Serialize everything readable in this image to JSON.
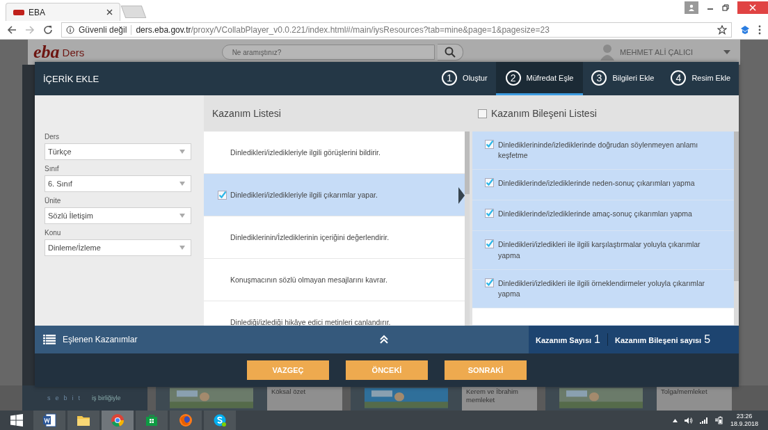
{
  "browser": {
    "tab_title": "EBA",
    "security": "Güvenli değil",
    "url_host": "ders.eba.gov.tr",
    "url_path": "/proxy/VCollabPlayer_v0.0.221/index.html#/main/iysResources?tab=mine&page=1&pagesize=23"
  },
  "page_header": {
    "logo": "eba",
    "logo_sub": "Ders",
    "search": {
      "placeholder": "Ne aramıştınız?"
    },
    "user": "MEHMET ALİ ÇALICI"
  },
  "modal": {
    "title": "İÇERİK EKLE",
    "steps": [
      {
        "number": "1",
        "label": "Oluştur",
        "selected": false
      },
      {
        "number": "2",
        "label": "Müfredat Eşle",
        "selected": true
      },
      {
        "number": "3",
        "label": "Bilgileri Ekle",
        "selected": false
      },
      {
        "number": "4",
        "label": "Resim Ekle",
        "selected": false
      }
    ],
    "filters": [
      {
        "label": "Ders",
        "value": "Türkçe"
      },
      {
        "label": "Sınıf",
        "value": "6. Sınıf"
      },
      {
        "label": "Ünite",
        "value": "Sözlü İletişim"
      },
      {
        "label": "Konu",
        "value": "Dinleme/İzleme"
      }
    ],
    "outcomes": {
      "title": "Kazanım Listesi",
      "items": [
        {
          "text": "Dinledikleri/izledikleriyle ilgili görüşlerini bildirir.",
          "selected": false
        },
        {
          "text": "Dinledikleri/izledikleriyle ilgili çıkarımlar yapar.",
          "selected": true
        },
        {
          "text": "Dinlediklerinin/İzlediklerinin içeriğini değerlendirir.",
          "selected": false
        },
        {
          "text": "Konuşmacının sözlü olmayan mesajlarını kavrar.",
          "selected": false
        },
        {
          "text": "Dinlediği/izlediği hikâye edici metinleri canlandırır.",
          "selected": false
        }
      ]
    },
    "components": {
      "title": "Kazanım Bileşeni Listesi",
      "all_checked": false,
      "items": [
        {
          "text": "Dinlediklerininde/izlediklerinde doğrudan söylenmeyen anlamı keşfetme",
          "checked": true
        },
        {
          "text": "Dinlediklerinde/izlediklerinde neden-sonuç çıkarımları yapma",
          "checked": true
        },
        {
          "text": "Dinlediklerinde/izlediklerinde amaç-sonuç çıkarımları yapma",
          "checked": true
        },
        {
          "text": "Dinledikleri/izledikleri ile ilgili karşılaştırmalar yoluyla çıkarımlar yapma",
          "checked": true
        },
        {
          "text": "Dinledikleri/izledikleri ile ilgili örneklendirmeler yoluyla çıkarımlar yapma",
          "checked": true
        }
      ]
    },
    "matched_label": "Eşlenen Kazanımlar",
    "counts": [
      {
        "label": "Kazanım Sayısı",
        "value": "1"
      },
      {
        "label": "Kazanım Bileşeni sayısı",
        "value": "5"
      }
    ],
    "buttons": [
      "VAZGEÇ",
      "ÖNCEKİ",
      "SONRAKİ"
    ]
  },
  "background": {
    "brand": "sebit",
    "brand_tagline": "iş birliğiyle",
    "captions": [
      "Köksal özet",
      "Kerem ve İbrahim memleket",
      "Tolga/memleket"
    ]
  },
  "taskbar": {
    "time": "23:26",
    "date": "18.9.2018"
  }
}
